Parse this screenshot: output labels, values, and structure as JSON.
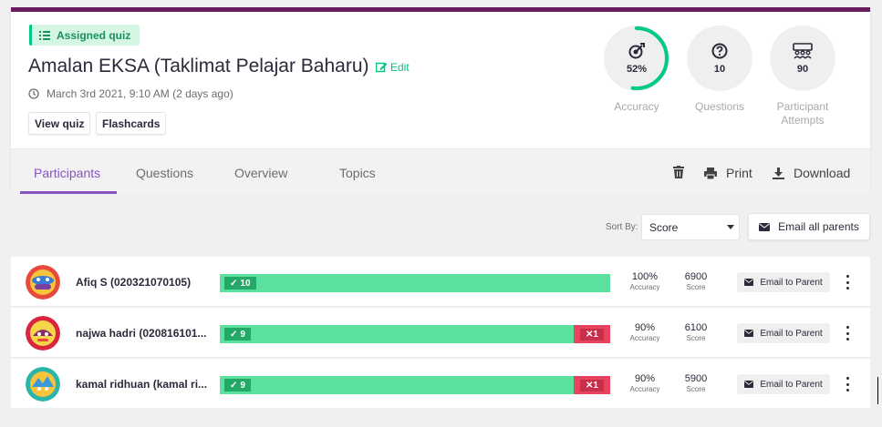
{
  "quiz": {
    "tag_label": "Assigned quiz",
    "title": "Amalan EKSA (Taklimat Pelajar Baharu)",
    "edit_label": "Edit",
    "date": "March 3rd 2021, 9:10 AM (2 days ago)",
    "view_quiz_label": "View quiz",
    "flashcards_label": "Flashcards"
  },
  "stats": [
    {
      "icon": "target-icon",
      "value": "52%",
      "label": "Accuracy",
      "progress": 0.52
    },
    {
      "icon": "question-circle-icon",
      "value": "10",
      "label": "Questions"
    },
    {
      "icon": "participants-icon",
      "value": "90",
      "label": "Participant Attempts"
    }
  ],
  "tabs": [
    {
      "label": "Participants",
      "active": true
    },
    {
      "label": "Questions"
    },
    {
      "label": "Overview"
    },
    {
      "label": "Topics"
    }
  ],
  "actions": {
    "print_label": "Print",
    "download_label": "Download"
  },
  "sort": {
    "label": "Sort By:",
    "selected": "Score"
  },
  "email_all_label": "Email all parents",
  "participants": [
    {
      "name": "Afiq S (020321070105)",
      "correct": "10",
      "incorrect": "",
      "accuracy": "100%",
      "accuracy_label": "Accuracy",
      "score": "6900",
      "score_label": "Score",
      "email_label": "Email to Parent"
    },
    {
      "name": "najwa hadri (020816101...",
      "correct": "9",
      "incorrect": "1",
      "accuracy": "90%",
      "accuracy_label": "Accuracy",
      "score": "6100",
      "score_label": "Score",
      "email_label": "Email to Parent"
    },
    {
      "name": "kamal ridhuan (kamal ri...",
      "correct": "9",
      "incorrect": "1",
      "accuracy": "90%",
      "accuracy_label": "Accuracy",
      "score": "5900",
      "score_label": "Score",
      "email_label": "Email to Parent"
    }
  ],
  "colors": {
    "accent": "#8854c0",
    "header_stripe": "#6a1b5f",
    "correct": "#5ce0a0",
    "incorrect": "#e8445f",
    "ring": "#00c985"
  }
}
